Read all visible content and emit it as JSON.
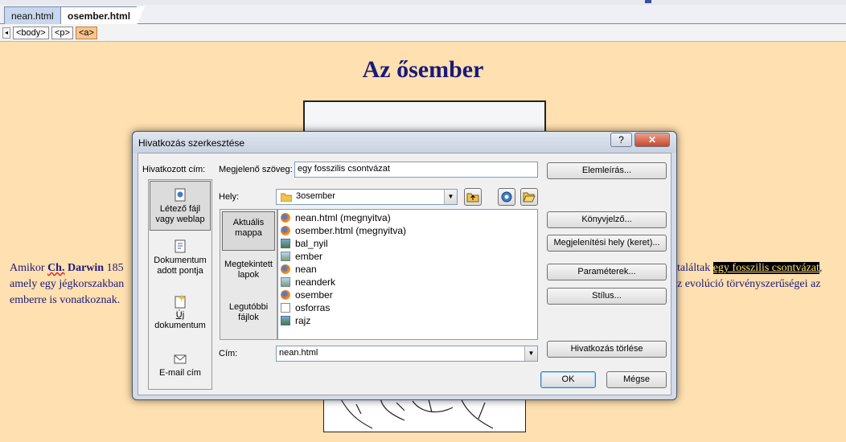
{
  "tabs": [
    {
      "label": "nean.html",
      "active": false
    },
    {
      "label": "osember.html",
      "active": true
    }
  ],
  "tag_selector": {
    "arrow": "◂",
    "tags": [
      "<body>",
      "<p>",
      "<a>"
    ],
    "selected": "<a>"
  },
  "page": {
    "title": "Az ősember",
    "para_left": {
      "line1_pre": "Amikor ",
      "line1_ch": "Ch.",
      "line1_darwin": " Darwin",
      "line1_rest": " 185",
      "line2": "amely egy jégkorszakban",
      "line3": "emberre is vonatkoznak."
    },
    "para_right": {
      "line1_pre": "találtak ",
      "line1_link": "egy fosszilis csontvázat",
      "line1_post": ",",
      "line2": "z evolúció törvényszerűségei az"
    }
  },
  "dialog": {
    "title": "Hivatkozás szerkesztése",
    "help_label": "?",
    "close_label": "✕",
    "link_to_label": "Hivatkozott cím:",
    "display_text_label": "Megjelenő szöveg:",
    "display_text_value": "egy fosszilis csontvázat",
    "location_label": "Hely:",
    "location_value": "3osember",
    "address_label": "Cím:",
    "address_value": "nean.html",
    "link_types": [
      {
        "label1": "Létező fájl",
        "label2": "vagy weblap",
        "icon": "existing-file-icon",
        "active": true
      },
      {
        "label1": "Dokumentum",
        "label2": "adott pontja",
        "icon": "document-place-icon",
        "active": false
      },
      {
        "label1": "Új",
        "label2": "dokumentum",
        "icon": "new-document-icon",
        "active": false
      },
      {
        "label1": "E-mail cím",
        "label2": "",
        "icon": "email-icon",
        "active": false
      }
    ],
    "browse_categories": [
      {
        "label1": "Aktuális",
        "label2": "mappa",
        "active": true
      },
      {
        "label1": "Megtekintett",
        "label2": "lapok",
        "active": false
      },
      {
        "label1": "Legutóbbi",
        "label2": "fájlok",
        "active": false
      }
    ],
    "files": [
      {
        "name": "nean.html (megnyitva)",
        "icon": "firefox-icon"
      },
      {
        "name": "osember.html (megnyitva)",
        "icon": "firefox-icon"
      },
      {
        "name": "bal_nyil",
        "icon": "image-icon"
      },
      {
        "name": "ember",
        "icon": "image-icon"
      },
      {
        "name": "nean",
        "icon": "firefox-icon"
      },
      {
        "name": "neanderk",
        "icon": "image-icon"
      },
      {
        "name": "osember",
        "icon": "firefox-icon"
      },
      {
        "name": "osforras",
        "icon": "text-file-icon"
      },
      {
        "name": "rajz",
        "icon": "image-icon"
      }
    ],
    "buttons": {
      "screentip": "Elemleírás...",
      "bookmark": "Könyvjelző...",
      "target_frame": "Megjelenítési hely (keret)...",
      "parameters": "Paraméterek...",
      "style": "Stílus...",
      "remove_link": "Hivatkozás törlése",
      "ok": "OK",
      "cancel": "Mégse"
    }
  }
}
